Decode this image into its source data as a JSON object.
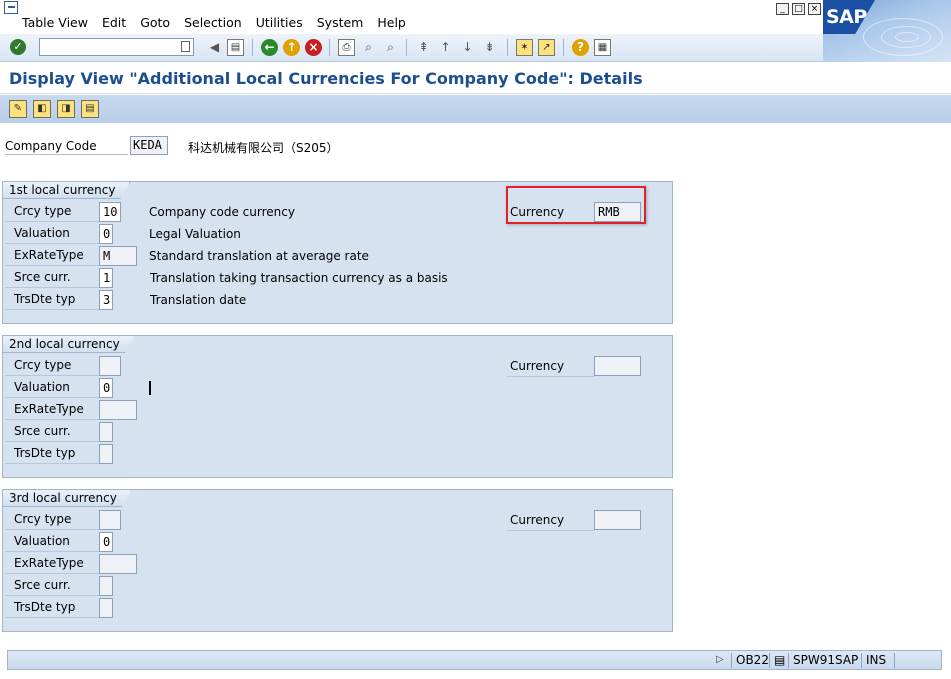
{
  "menu": {
    "items": [
      {
        "label": "Table View"
      },
      {
        "label": "Edit"
      },
      {
        "label": "Goto"
      },
      {
        "label": "Selection"
      },
      {
        "label": "Utilities"
      },
      {
        "label": "System"
      },
      {
        "label": "Help"
      }
    ],
    "window_buttons": [
      "minimize-icon",
      "restore-icon",
      "close-icon"
    ],
    "logo": "SAP"
  },
  "toolbar": {
    "command_field": {
      "value": "",
      "placeholder": ""
    },
    "icons": [
      "enter-icon",
      "back-arrow-icon",
      "save-icon",
      "back-icon",
      "exit-icon",
      "cancel-icon",
      "print-icon",
      "find-icon",
      "find-next-icon",
      "first-page-icon",
      "previous-page-icon",
      "next-page-icon",
      "last-page-icon",
      "create-session-icon",
      "shortcut-icon",
      "help-icon",
      "layout-icon"
    ]
  },
  "title": "Display View \"Additional Local Currencies For Company Code\": Details",
  "app_toolbar": {
    "icons": [
      "display-change-icon",
      "previous-entry-icon",
      "next-entry-icon",
      "variable-list-icon"
    ]
  },
  "header": {
    "company_code_label": "Company Code",
    "company_code_value": "KEDA",
    "company_name": "科达机械有限公司（S205）"
  },
  "groups": [
    {
      "title": "1st local currency",
      "fields": {
        "crcy_type": {
          "label": "Crcy type",
          "value": "10",
          "desc": "Company code currency"
        },
        "valuation": {
          "label": "Valuation",
          "value": "0",
          "desc": "Legal Valuation"
        },
        "exratetype": {
          "label": "ExRateType",
          "value": "M",
          "desc": "Standard translation at average rate"
        },
        "srce_curr": {
          "label": "Srce curr.",
          "value": "1",
          "desc": "Translation taking transaction currency as a basis"
        },
        "trsdte_typ": {
          "label": "TrsDte typ",
          "value": "3",
          "desc": "Translation date"
        }
      },
      "currency": {
        "label": "Currency",
        "value": "RMB"
      }
    },
    {
      "title": "2nd local currency",
      "fields": {
        "crcy_type": {
          "label": "Crcy type",
          "value": ""
        },
        "valuation": {
          "label": "Valuation",
          "value": "0"
        },
        "exratetype": {
          "label": "ExRateType",
          "value": ""
        },
        "srce_curr": {
          "label": "Srce curr.",
          "value": ""
        },
        "trsdte_typ": {
          "label": "TrsDte typ",
          "value": ""
        }
      },
      "currency": {
        "label": "Currency",
        "value": ""
      }
    },
    {
      "title": "3rd local currency",
      "fields": {
        "crcy_type": {
          "label": "Crcy type",
          "value": ""
        },
        "valuation": {
          "label": "Valuation",
          "value": "0"
        },
        "exratetype": {
          "label": "ExRateType",
          "value": ""
        },
        "srce_curr": {
          "label": "Srce curr.",
          "value": ""
        },
        "trsdte_typ": {
          "label": "TrsDte typ",
          "value": ""
        }
      },
      "currency": {
        "label": "Currency",
        "value": ""
      }
    }
  ],
  "status": {
    "transaction": "OB22",
    "server": "SPW91SAP",
    "mode": "INS"
  },
  "colors": {
    "title": "#1c4f8f",
    "group_bg": "#d6e2ef",
    "highlight": "#e0202a"
  }
}
